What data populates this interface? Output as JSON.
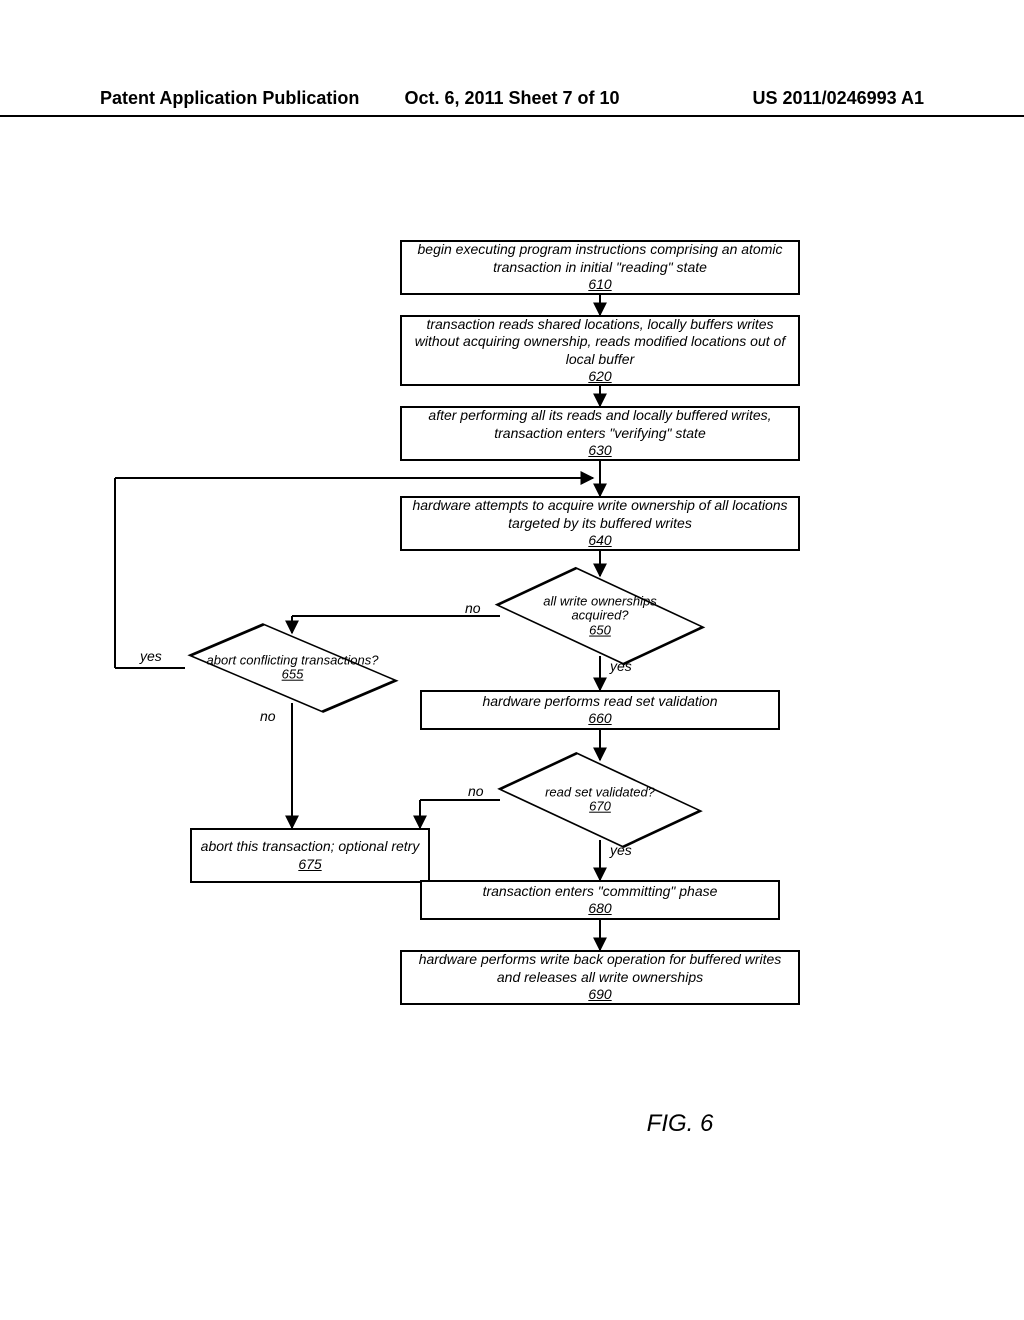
{
  "header": {
    "left": "Patent Application Publication",
    "center": "Oct. 6, 2011   Sheet 7 of 10",
    "right": "US 2011/0246993 A1"
  },
  "figure_caption": "FIG. 6",
  "nodes": {
    "n610": {
      "text": "begin executing program instructions comprising an atomic transaction in initial \"reading\" state",
      "ref": "610"
    },
    "n620": {
      "text": "transaction reads shared locations, locally buffers writes without acquiring ownership, reads modified locations out of local buffer",
      "ref": "620"
    },
    "n630": {
      "text": "after performing all its reads and locally buffered writes, transaction enters \"verifying\" state",
      "ref": "630"
    },
    "n640": {
      "text": "hardware attempts to acquire write ownership of all locations targeted by its buffered writes",
      "ref": "640"
    },
    "n650": {
      "text": "all write ownerships acquired?",
      "ref": "650"
    },
    "n655": {
      "text": "abort conflicting transactions?",
      "ref": "655"
    },
    "n660": {
      "text": "hardware performs read set validation",
      "ref": "660"
    },
    "n670": {
      "text": "read set validated?",
      "ref": "670"
    },
    "n675": {
      "text": "abort this transaction; optional retry",
      "ref": "675"
    },
    "n680": {
      "text": "transaction enters \"committing\" phase",
      "ref": "680"
    },
    "n690": {
      "text": "hardware performs write back operation for buffered writes and releases all write ownerships",
      "ref": "690"
    }
  },
  "labels": {
    "no": "no",
    "yes": "yes"
  },
  "chart_data": {
    "type": "flowchart",
    "title": "FIG. 6",
    "nodes": [
      {
        "id": "610",
        "shape": "process",
        "text": "begin executing program instructions comprising an atomic transaction in initial \"reading\" state"
      },
      {
        "id": "620",
        "shape": "process",
        "text": "transaction reads shared locations, locally buffers writes without acquiring ownership, reads modified locations out of local buffer"
      },
      {
        "id": "630",
        "shape": "process",
        "text": "after performing all its reads and locally buffered writes, transaction enters \"verifying\" state"
      },
      {
        "id": "640",
        "shape": "process",
        "text": "hardware attempts to acquire write ownership of all locations targeted by its buffered writes"
      },
      {
        "id": "650",
        "shape": "decision",
        "text": "all write ownerships acquired?"
      },
      {
        "id": "655",
        "shape": "decision",
        "text": "abort conflicting transactions?"
      },
      {
        "id": "660",
        "shape": "process",
        "text": "hardware performs read set validation"
      },
      {
        "id": "670",
        "shape": "decision",
        "text": "read set validated?"
      },
      {
        "id": "675",
        "shape": "process",
        "text": "abort this transaction; optional retry"
      },
      {
        "id": "680",
        "shape": "process",
        "text": "transaction enters \"committing\" phase"
      },
      {
        "id": "690",
        "shape": "process",
        "text": "hardware performs write back operation for buffered writes and releases all write ownerships"
      }
    ],
    "edges": [
      {
        "from": "610",
        "to": "620",
        "label": ""
      },
      {
        "from": "620",
        "to": "630",
        "label": ""
      },
      {
        "from": "630",
        "to": "640",
        "label": ""
      },
      {
        "from": "640",
        "to": "650",
        "label": ""
      },
      {
        "from": "650",
        "to": "660",
        "label": "yes"
      },
      {
        "from": "650",
        "to": "655",
        "label": "no"
      },
      {
        "from": "655",
        "to": "640",
        "label": "yes"
      },
      {
        "from": "655",
        "to": "675",
        "label": "no"
      },
      {
        "from": "660",
        "to": "670",
        "label": ""
      },
      {
        "from": "670",
        "to": "680",
        "label": "yes"
      },
      {
        "from": "670",
        "to": "675",
        "label": "no"
      },
      {
        "from": "680",
        "to": "690",
        "label": ""
      }
    ]
  }
}
